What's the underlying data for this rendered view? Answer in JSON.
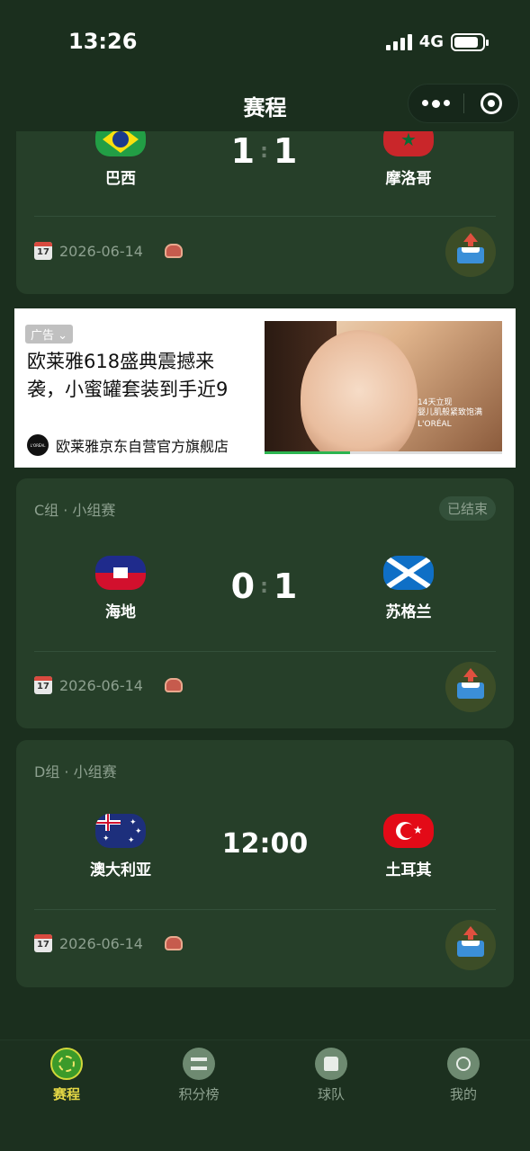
{
  "status_bar": {
    "time": "13:26",
    "network": "4G"
  },
  "nav": {
    "title": "赛程"
  },
  "matches": [
    {
      "group": "",
      "status": "",
      "home": {
        "name": "巴西",
        "flag": "brazil"
      },
      "away": {
        "name": "摩洛哥",
        "flag": "morocco"
      },
      "home_score": "1",
      "away_score": "1",
      "date": "2026-06-14"
    },
    {
      "group": "C组 · 小组赛",
      "status": "已结束",
      "home": {
        "name": "海地",
        "flag": "haiti"
      },
      "away": {
        "name": "苏格兰",
        "flag": "scotland"
      },
      "home_score": "0",
      "away_score": "1",
      "date": "2026-06-14"
    },
    {
      "group": "D组 · 小组赛",
      "status": "",
      "home": {
        "name": "澳大利亚",
        "flag": "australia"
      },
      "away": {
        "name": "土耳其",
        "flag": "turkey"
      },
      "kickoff": "12:00",
      "date": "2026-06-14"
    }
  ],
  "ad": {
    "tag": "广告",
    "title": "欧莱雅618盛典震撼来袭，小蜜罐套装到手近9",
    "brand": "欧莱雅京东自营官方旗舰店",
    "image_text_1": "L'ORÉAL",
    "image_text_2": "14天立现",
    "image_text_3": "婴儿肌般紧致饱满",
    "progress": 0.36
  },
  "tabs": [
    {
      "label": "赛程",
      "active": true
    },
    {
      "label": "积分榜",
      "active": false
    },
    {
      "label": "球队",
      "active": false
    },
    {
      "label": "我的",
      "active": false
    }
  ],
  "colors": {
    "background": "#1b2f1e",
    "card": "#263f29",
    "active_tab": "#e6d845",
    "muted": "#8da08f"
  }
}
